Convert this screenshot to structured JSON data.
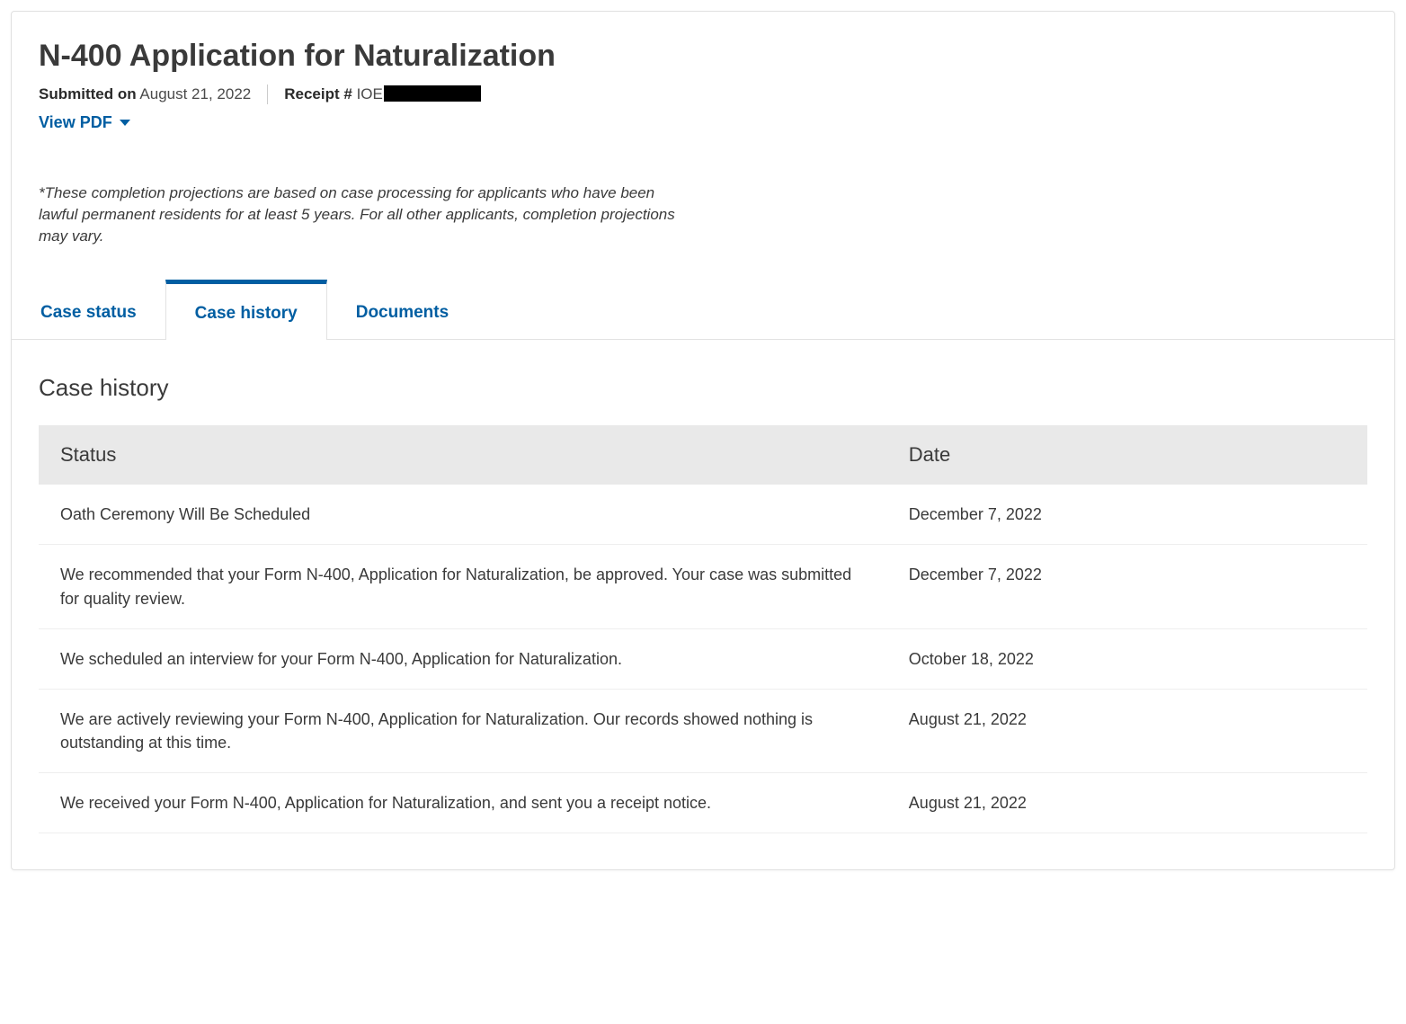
{
  "header": {
    "title": "N-400 Application for Naturalization",
    "submitted_label": "Submitted on",
    "submitted_date": "August 21, 2022",
    "receipt_label": "Receipt #",
    "receipt_prefix": "IOE",
    "view_pdf_label": "View PDF"
  },
  "disclaimer": "*These completion projections are based on case processing for applicants who have been lawful permanent residents for at least 5 years. For all other applicants, completion projections may vary.",
  "tabs": {
    "case_status": "Case status",
    "case_history": "Case history",
    "documents": "Documents",
    "active": "case_history"
  },
  "section": {
    "title": "Case history",
    "columns": {
      "status": "Status",
      "date": "Date"
    }
  },
  "history": [
    {
      "status": "Oath Ceremony Will Be Scheduled",
      "date": "December 7, 2022"
    },
    {
      "status": "We recommended that your Form N-400, Application for Naturalization, be approved. Your case was submitted for quality review.",
      "date": "December 7, 2022"
    },
    {
      "status": "We scheduled an interview for your Form N-400, Application for Naturalization.",
      "date": "October 18, 2022"
    },
    {
      "status": "We are actively reviewing your Form N-400, Application for Naturalization. Our records showed nothing is outstanding at this time.",
      "date": "August 21, 2022"
    },
    {
      "status": "We received your Form N-400, Application for Naturalization, and sent you a receipt notice.",
      "date": "August 21, 2022"
    }
  ]
}
